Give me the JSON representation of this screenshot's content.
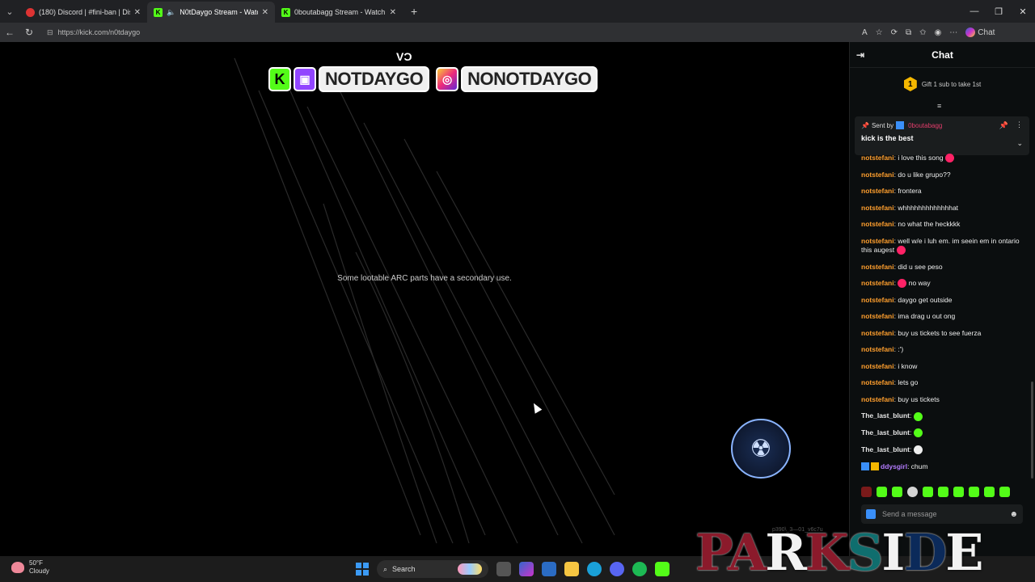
{
  "browser": {
    "tabs": [
      {
        "title": "(180) Discord | #fini-ban | District",
        "favicon": "discord",
        "active": false
      },
      {
        "title": "N0tDaygo Stream - Watch Live",
        "favicon": "kick",
        "active": true,
        "muted_icon": "speaker-icon"
      },
      {
        "title": "0boutabagg Stream - Watch Live",
        "favicon": "kick",
        "active": false
      }
    ],
    "url": "https://kick.com/n0tdaygo",
    "chat_button_label": "Chat"
  },
  "stream": {
    "top_mark": "VƆ",
    "social_handles": [
      {
        "platforms": [
          "kick",
          "twitch"
        ],
        "handle": "NOTDAYGO"
      },
      {
        "platforms": [
          "instagram"
        ],
        "handle": "NONOTDAYGO"
      }
    ],
    "loading_tip": "Some lootable ARC parts have a secondary use.",
    "code_text": "p390\\_3—01_v6c7u"
  },
  "chat": {
    "title": "Chat",
    "gift_count": "1",
    "gift_text": "Gift 1 sub to take 1st",
    "pinned": {
      "sent_by_label": "Sent by",
      "user": "0boutabagg",
      "message": "kick is the best"
    },
    "messages": [
      {
        "user": "notstefani",
        "text": ": i love this song",
        "emote": "pink",
        "style": "orange"
      },
      {
        "user": "notstefani",
        "text": ": do u like grupo??",
        "style": "orange"
      },
      {
        "user": "notstefani",
        "text": ": frontera",
        "style": "orange"
      },
      {
        "user": "notstefani",
        "text": ": whhhhhhhhhhhhhat",
        "style": "orange"
      },
      {
        "user": "notstefani",
        "text": ": no what the heckkkk",
        "style": "orange"
      },
      {
        "user": "notstefani",
        "text": ": well w/e i luh em. im seein em in ontario this augest",
        "emote": "pink",
        "style": "orange"
      },
      {
        "user": "notstefani",
        "text": ": did u see peso",
        "style": "orange"
      },
      {
        "user": "notstefani",
        "text": ": no way",
        "emote_before": "pink",
        "style": "orange"
      },
      {
        "user": "notstefani",
        "text": ": daygo get outside",
        "style": "orange"
      },
      {
        "user": "notstefani",
        "text": ": ima drag u out ong",
        "style": "orange"
      },
      {
        "user": "notstefani",
        "text": ": buy us tickets to see fuerza",
        "style": "orange"
      },
      {
        "user": "notstefani",
        "text": ": :')",
        "style": "orange"
      },
      {
        "user": "notstefani",
        "text": ": i know",
        "style": "orange"
      },
      {
        "user": "notstefani",
        "text": ": lets go",
        "style": "orange"
      },
      {
        "user": "notstefani",
        "text": ": buy us tickets",
        "style": "orange"
      },
      {
        "user": "The_last_blunt",
        "text": ":",
        "emote": "green",
        "style": "grey"
      },
      {
        "user": "The_last_blunt",
        "text": ":",
        "emote": "green",
        "style": "grey"
      },
      {
        "user": "The_last_blunt",
        "text": ":",
        "emote": "white",
        "style": "grey"
      },
      {
        "user": "ddysgirl",
        "text": ": chum",
        "badges": [
          "blue",
          "gold"
        ],
        "style": "purple"
      }
    ],
    "send_placeholder": "Send a message"
  },
  "taskbar": {
    "weather_temp": "50°F",
    "weather_desc": "Cloudy",
    "search_label": "Search"
  },
  "wallpaper_logo": "PARKSIDE"
}
